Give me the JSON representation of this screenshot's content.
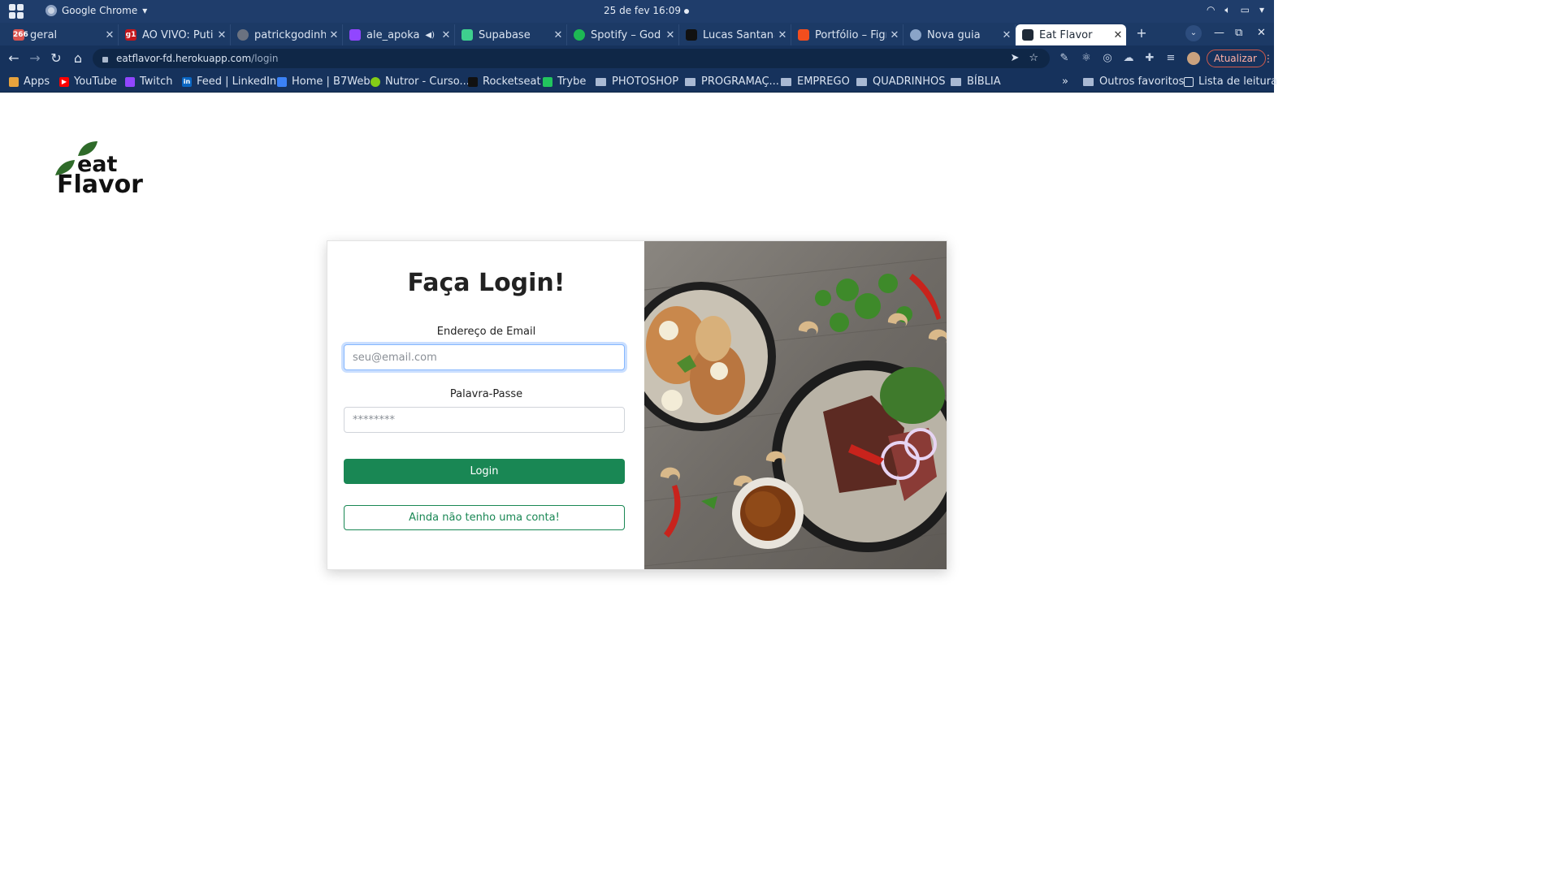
{
  "os_bar": {
    "app_name": "Google Chrome",
    "clock": "25 de fev  16:09"
  },
  "tabs": [
    {
      "title": "geral",
      "favicon_color": "#d9534f",
      "favicon_text": "266"
    },
    {
      "title": "AO VIVO: Putin",
      "favicon_color": "#c4161c",
      "favicon_text": "g1"
    },
    {
      "title": "patrickgodinho",
      "favicon_color": "#6b7280",
      "favicon_text": ""
    },
    {
      "title": "ale_apoka",
      "favicon_color": "#9146ff",
      "favicon_text": ""
    },
    {
      "title": "Supabase",
      "favicon_color": "#3ecf8e",
      "favicon_text": ""
    },
    {
      "title": "Spotify – God Is",
      "favicon_color": "#1db954",
      "favicon_text": ""
    },
    {
      "title": "Lucas Santana",
      "favicon_color": "#111111",
      "favicon_text": ""
    },
    {
      "title": "Portfólio – Figm",
      "favicon_color": "#f24e1e",
      "favicon_text": ""
    },
    {
      "title": "Nova guia",
      "favicon_color": "#8aa4c8",
      "favicon_text": ""
    },
    {
      "title": "Eat Flavor",
      "favicon_color": "#1f2a37",
      "favicon_text": ""
    }
  ],
  "toolbar": {
    "url_host": "eatflavor-fd.herokuapp.com",
    "url_path": "/login",
    "update_label": "Atualizar"
  },
  "bookmarks": [
    {
      "label": "Apps",
      "icon": "apps-grid-icon",
      "color": "#e8a33d"
    },
    {
      "label": "YouTube",
      "icon": "youtube-icon",
      "color": "#ff0000"
    },
    {
      "label": "Twitch",
      "icon": "twitch-icon",
      "color": "#9146ff"
    },
    {
      "label": "Feed | LinkedIn",
      "icon": "linkedin-icon",
      "color": "#0a66c2"
    },
    {
      "label": "Home | B7Web",
      "icon": "b7web-icon",
      "color": "#3b82f6"
    },
    {
      "label": "Nutror - Curso...",
      "icon": "nutror-icon",
      "color": "#84cc16"
    },
    {
      "label": "Rocketseat",
      "icon": "rocketseat-icon",
      "color": "#111111"
    },
    {
      "label": "Trybe",
      "icon": "trybe-icon",
      "color": "#22c55e"
    },
    {
      "label": "PHOTOSHOP",
      "icon": "folder-icon"
    },
    {
      "label": "PROGRAMAÇ...",
      "icon": "folder-icon"
    },
    {
      "label": "EMPREGO",
      "icon": "folder-icon"
    },
    {
      "label": "QUADRINHOS",
      "icon": "folder-icon"
    },
    {
      "label": "BÍBLIA",
      "icon": "folder-icon"
    }
  ],
  "bookmarks_right": {
    "overflow": "»",
    "other": "Outros favoritos",
    "reading_list": "Lista de leitura"
  },
  "page": {
    "logo_line1": "eat",
    "logo_line2": "Flavor",
    "title": "Faça Login!",
    "email_label": "Endereço de Email",
    "email_placeholder": "seu@email.com",
    "password_label": "Palavra-Passe",
    "password_placeholder": "********",
    "login_button": "Login",
    "signup_button": "Ainda não tenho uma conta!"
  },
  "colors": {
    "brand_green": "#198754",
    "leaf_green": "#2f6b2a",
    "os_bar": "#1f3d6b",
    "toolbar": "#16325c"
  }
}
